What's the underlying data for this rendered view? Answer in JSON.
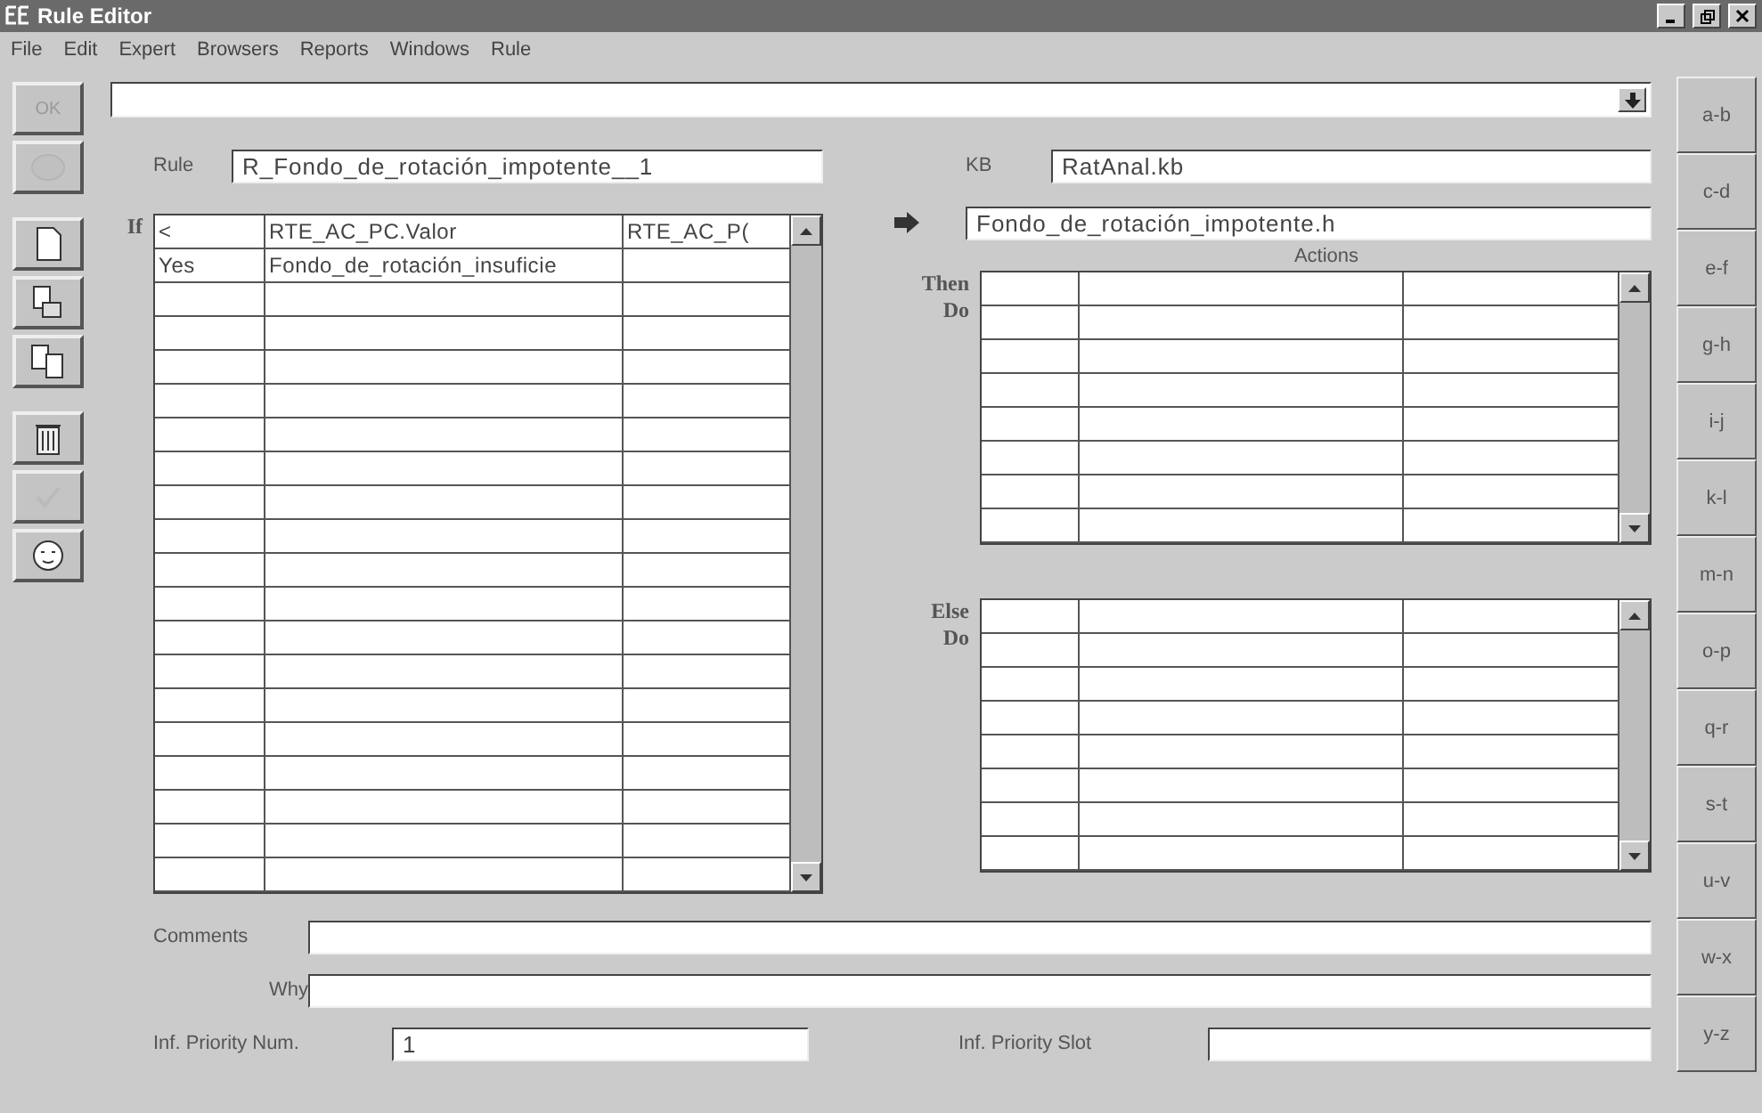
{
  "window": {
    "title": "Rule Editor"
  },
  "menu": [
    "File",
    "Edit",
    "Expert",
    "Browsers",
    "Reports",
    "Windows",
    "Rule"
  ],
  "toolbar": [
    {
      "kind": "ok",
      "label": "OK",
      "disabled": true
    },
    {
      "kind": "circle",
      "disabled": true
    },
    {
      "kind": "new",
      "disabled": false
    },
    {
      "kind": "copy",
      "disabled": false
    },
    {
      "kind": "duplicate",
      "disabled": false
    },
    {
      "kind": "delete",
      "disabled": false
    },
    {
      "kind": "check",
      "disabled": true
    },
    {
      "kind": "help",
      "disabled": false
    }
  ],
  "rule": {
    "label": "Rule",
    "value": "R_Fondo_de_rotación_impotente__1"
  },
  "if_label": "If",
  "if_table": {
    "rows": [
      [
        "<",
        "RTE_AC_PC.Valor",
        "RTE_AC_P("
      ],
      [
        "Yes",
        "Fondo_de_rotación_insuficie",
        ""
      ]
    ]
  },
  "kb": {
    "label": "KB",
    "value": "RatAnal.kb"
  },
  "hypothesis": {
    "value": "Fondo_de_rotación_impotente.h"
  },
  "actions_title": "Actions",
  "then_label": "Then\nDo",
  "else_label": "Else\nDo",
  "comments": {
    "label": "Comments"
  },
  "why": {
    "label": "Why"
  },
  "priority_num": {
    "label": "Inf. Priority Num.",
    "value": "1"
  },
  "priority_slot": {
    "label": "Inf. Priority Slot"
  },
  "alphabet": [
    "a-b",
    "c-d",
    "e-f",
    "g-h",
    "i-j",
    "k-l",
    "m-n",
    "o-p",
    "q-r",
    "s-t",
    "u-v",
    "w-x",
    "y-z"
  ]
}
